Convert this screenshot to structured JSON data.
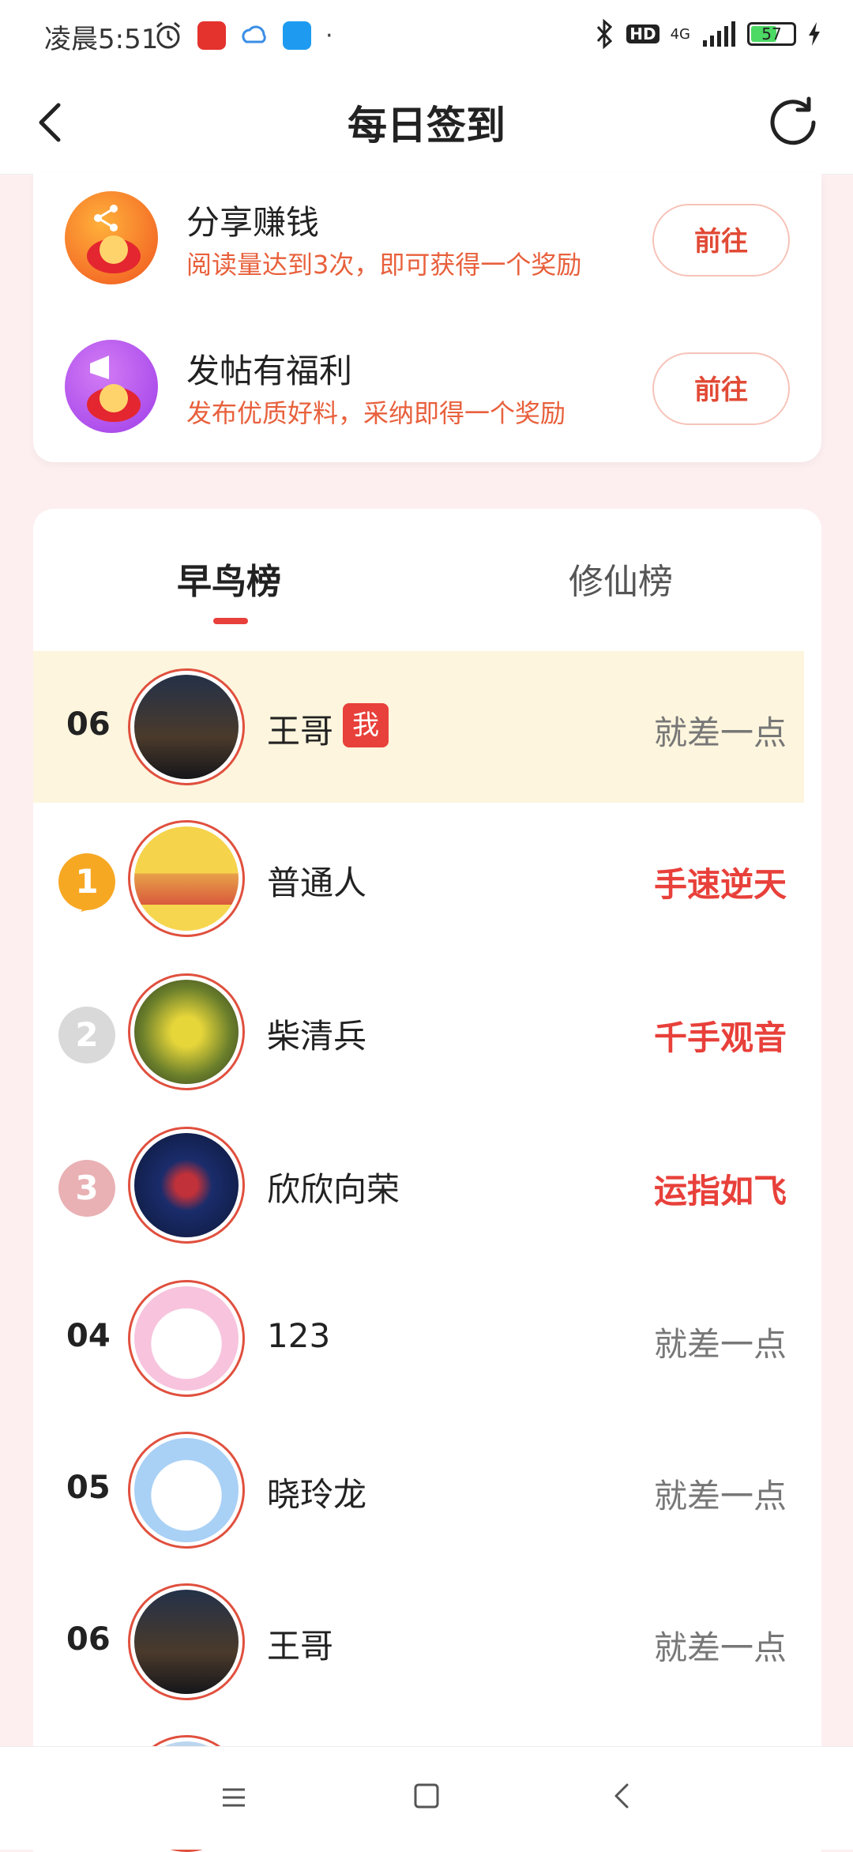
{
  "status_bar": {
    "time": "凌晨5:51",
    "network": "4G",
    "hd": "HD",
    "battery_level": "57"
  },
  "header": {
    "title": "每日签到"
  },
  "tasks": [
    {
      "title": "分享赚钱",
      "desc": "阅读量达到3次，即可获得一个奖励",
      "button": "前往"
    },
    {
      "title": "发帖有福利",
      "desc": "发布优质好料，采纳即得一个奖励",
      "button": "前往"
    }
  ],
  "ranking": {
    "tabs": [
      "早鸟榜",
      "修仙榜"
    ],
    "active_tab": 0,
    "me_badge": "我",
    "rows": [
      {
        "rank": "06",
        "name": "王哥",
        "status": "就差一点",
        "me": true
      },
      {
        "rank": "1",
        "name": "普通人",
        "status": "手速逆天"
      },
      {
        "rank": "2",
        "name": "柴清兵",
        "status": "千手观音"
      },
      {
        "rank": "3",
        "name": "欣欣向荣",
        "status": "运指如飞"
      },
      {
        "rank": "04",
        "name": "123",
        "status": "就差一点"
      },
      {
        "rank": "05",
        "name": "晓玲龙",
        "status": "就差一点"
      },
      {
        "rank": "06",
        "name": "王哥",
        "status": "就差一点"
      }
    ]
  },
  "colors": {
    "accent": "#e8403a",
    "highlight_row": "#fdf5dd",
    "gold": "#f7a823",
    "silver": "#d9d9d9",
    "bronze": "#e9b1b4"
  }
}
